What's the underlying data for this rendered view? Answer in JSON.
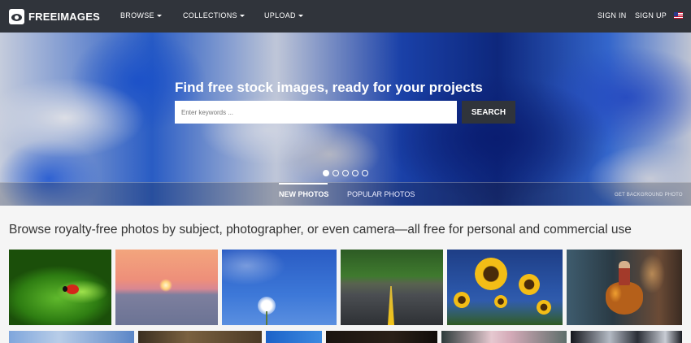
{
  "brand": {
    "name": "FREEIMAGES"
  },
  "nav": {
    "items": [
      {
        "label": "BROWSE"
      },
      {
        "label": "COLLECTIONS"
      },
      {
        "label": "UPLOAD"
      }
    ],
    "sign_in": "SIGN IN",
    "sign_up": "SIGN UP",
    "language_icon": "us-flag-icon"
  },
  "hero": {
    "title": "Find free stock images, ready for your projects",
    "search_placeholder": "Enter keywords ...",
    "search_button": "SEARCH",
    "slides": 5,
    "active_slide": 1,
    "tabs": [
      {
        "label": "NEW PHOTOS",
        "active": true
      },
      {
        "label": "POPULAR PHOTOS",
        "active": false
      }
    ],
    "background_link": "GET BACKGROUND PHOTO"
  },
  "main": {
    "tagline": "Browse royalty-free photos by subject, photographer, or even camera—all free for personal and commercial use"
  },
  "colors": {
    "nav_bg": "#30343b",
    "button_bg": "#30343b",
    "accent_text": "#ffffff",
    "page_bg": "#f5f5f5"
  }
}
